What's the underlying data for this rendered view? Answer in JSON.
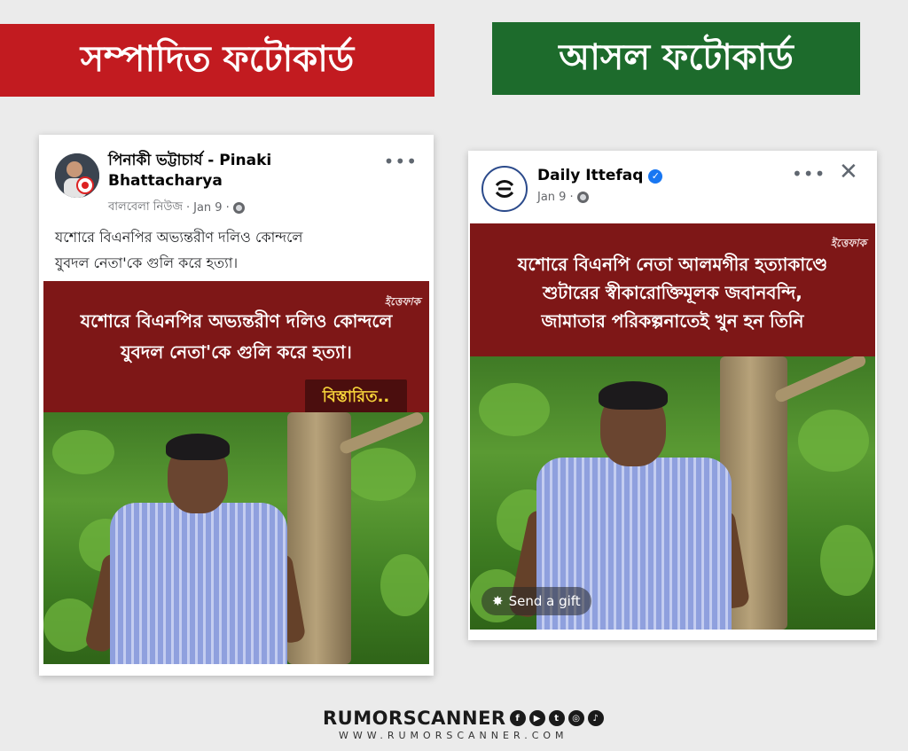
{
  "banners": {
    "left": "সম্পাদিত ফটোকার্ড",
    "right": "আসল ফটোকার্ড"
  },
  "left_post": {
    "author": "পিনাকী ভট্টাচার্য - Pinaki Bhattacharya",
    "source": "বালবেলা নিউজ",
    "date": "Jan 9",
    "caption_line1": "যশোরে বিএনপির অভ্যন্তরীণ দলিও কোন্দলে",
    "caption_line2": "যুবদল নেতা'কে গুলি করে হত্যা।",
    "card_line1": "যশোরে বিএনপির অভ্যন্তরীণ দলিও কোন্দলে",
    "card_line2": "যুবদল নেতা'কে গুলি করে হত্যা।",
    "brand_mark": "ইত্তেফাক",
    "detail_badge": "বিস্তারিত..",
    "more_icon": "•••"
  },
  "right_post": {
    "author": "Daily Ittefaq",
    "date": "Jan 9",
    "card_line1": "যশোরে বিএনপি নেতা আলমগীর হত্যাকাণ্ডে",
    "card_line2": "শুটারের স্বীকারোক্তিমূলক জবানবন্দি,",
    "card_line3": "জামাতার পরিকল্পনাতেই খুন হন তিনি",
    "brand_mark": "ইত্তেফাক",
    "gift_label": "Send a gift",
    "more_icon": "•••",
    "close_icon": "✕"
  },
  "footer": {
    "brand": "RUMORSCANNER",
    "url": "WWW.RUMORSCANNER.COM",
    "social_icons": [
      "facebook-icon",
      "youtube-icon",
      "twitter-icon",
      "instagram-icon",
      "tiktok-icon"
    ]
  },
  "colors": {
    "left_banner": "#c21b20",
    "right_banner": "#1d6b2c",
    "card_headline_bg": "#7e1717",
    "badge_text": "#f6d33a",
    "verified": "#1877f2"
  }
}
